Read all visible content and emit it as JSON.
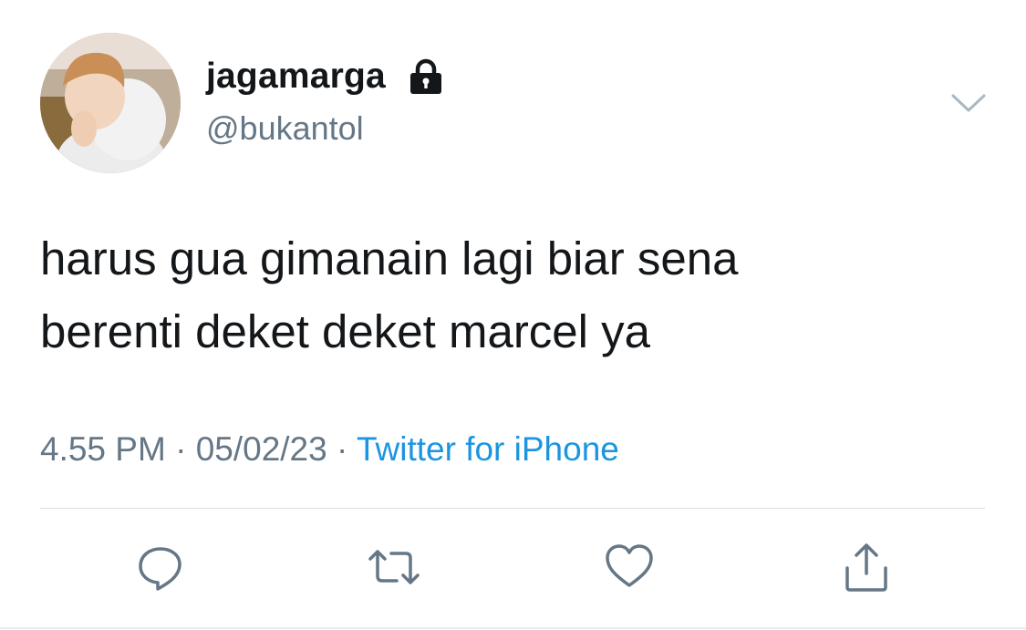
{
  "user": {
    "display_name": "jagamarga",
    "handle": "@bukantol",
    "protected_icon": "lock-icon",
    "avatar": "profile-photo"
  },
  "tweet": {
    "text": "harus gua gimanain lagi biar sena\nberenti deket deket marcel ya",
    "time": "4.55 PM",
    "date": "05/02/23",
    "separator": "·",
    "source": "Twitter for iPhone"
  },
  "menu": {
    "icon": "chevron-down-icon"
  },
  "actions": [
    {
      "name": "reply",
      "icon": "comment-icon"
    },
    {
      "name": "retweet",
      "icon": "retweet-icon"
    },
    {
      "name": "like",
      "icon": "heart-icon"
    },
    {
      "name": "share",
      "icon": "share-icon"
    }
  ],
  "colors": {
    "text_primary": "#14171a",
    "text_secondary": "#657786",
    "link": "#1b95e0",
    "divider": "#d8dee2"
  }
}
